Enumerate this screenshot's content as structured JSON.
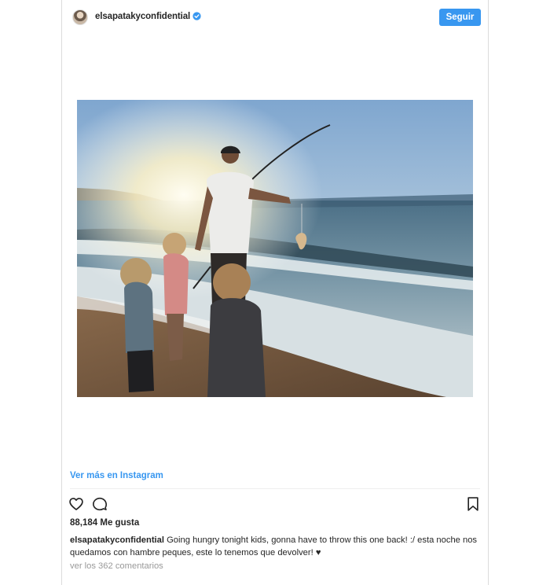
{
  "post": {
    "username": "elsapatakyconfidential",
    "follow_label": "Seguir",
    "see_more": "Ver más en Instagram",
    "likes": "88,184 Me gusta",
    "caption_user": "elsapatakyconfidential",
    "caption_text": " Going hungry tonight kids, gonna have to throw this one back! :/ esta noche nos quedamos con hambre peques, este lo tenemos que devolver! ♥",
    "view_comments": "ver los 362 comentarios"
  },
  "icons": {
    "verified": "verified-badge-icon",
    "like": "heart-icon",
    "comment": "comment-bubble-icon",
    "save": "bookmark-icon"
  },
  "colors": {
    "accent": "#3897f0",
    "text": "#262626",
    "muted": "#999999",
    "border": "#dbdbdb"
  }
}
